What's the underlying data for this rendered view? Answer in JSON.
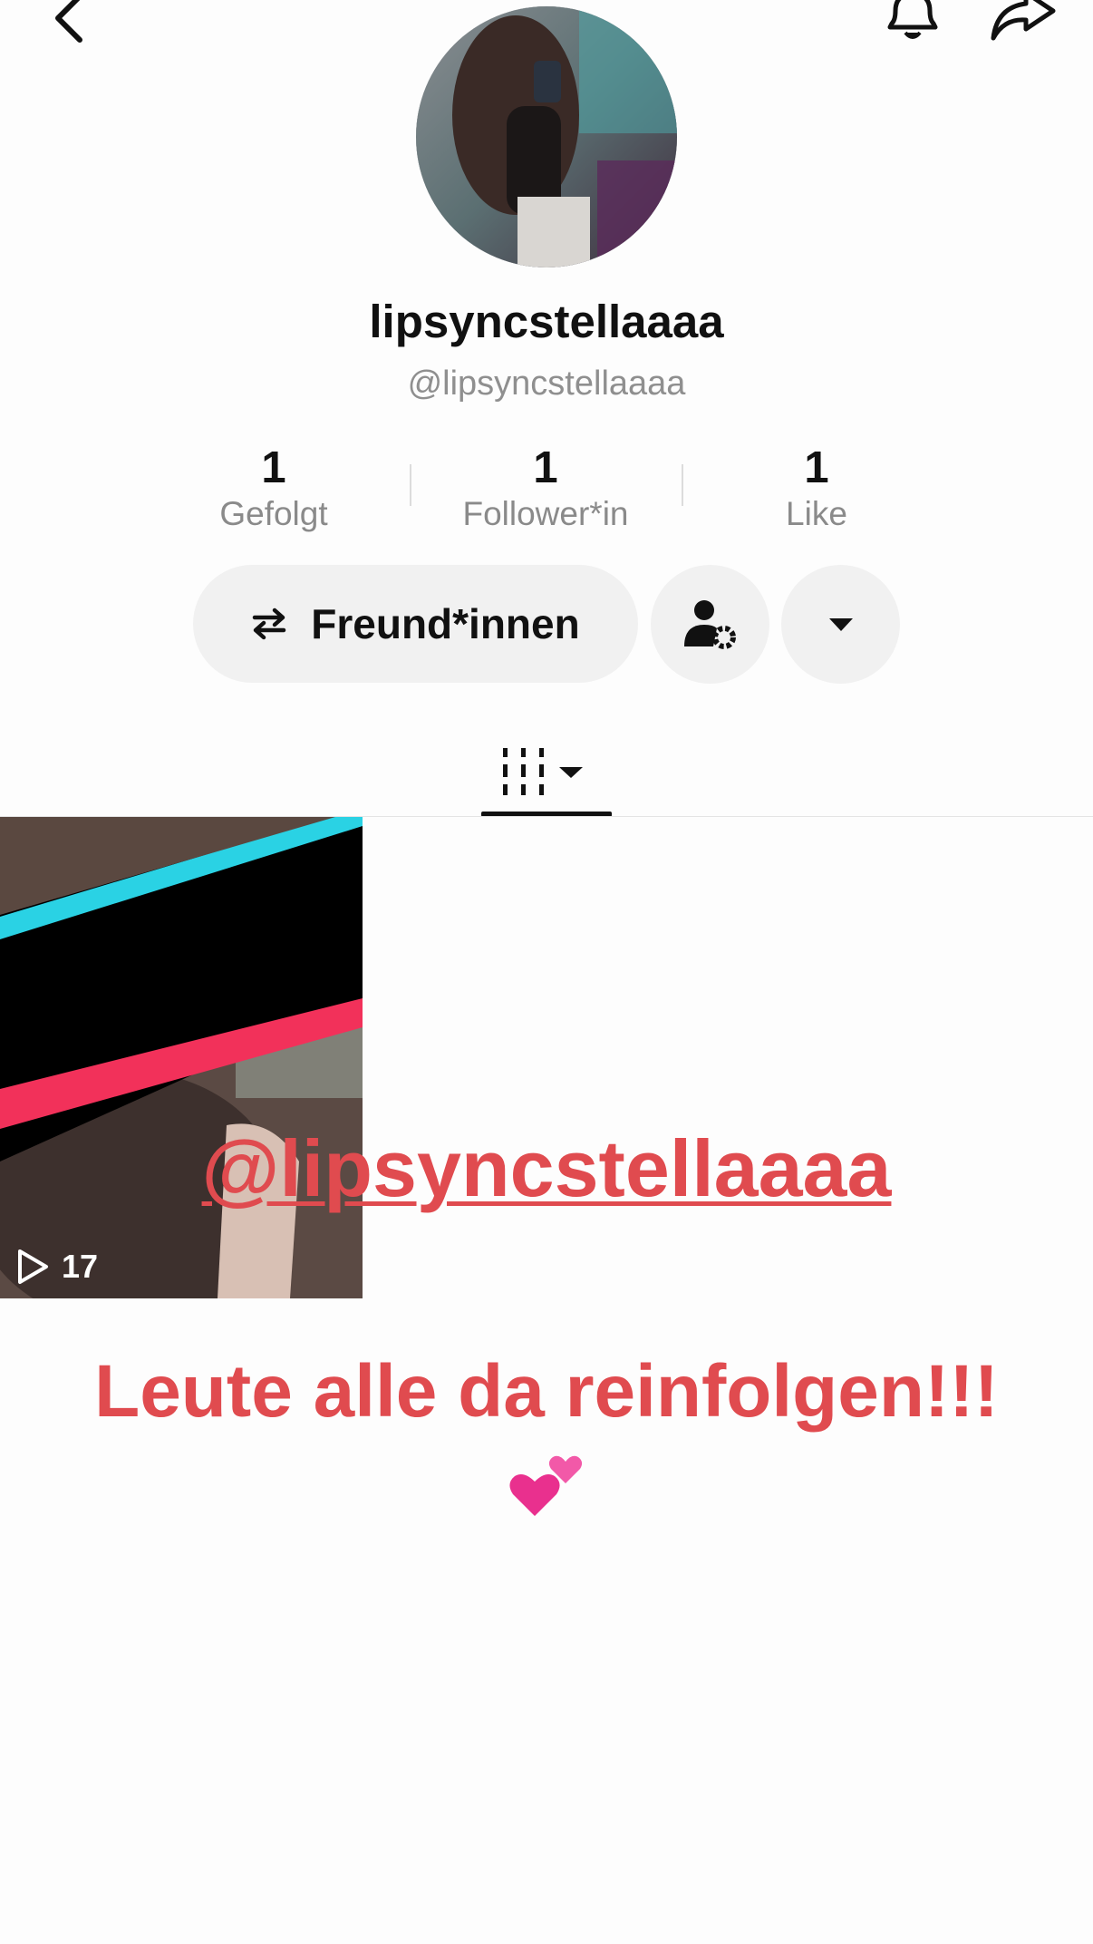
{
  "profile": {
    "display_name": "lipsyncstellaaaa",
    "handle": "@lipsyncstellaaaa"
  },
  "stats": [
    {
      "count": "1",
      "label": "Gefolgt"
    },
    {
      "count": "1",
      "label": "Follower*in"
    },
    {
      "count": "1",
      "label": "Like"
    }
  ],
  "actions": {
    "friends_label": "Freund*innen"
  },
  "videos": [
    {
      "views": "17"
    }
  ],
  "overlay": {
    "mention": "@lipsyncstellaaaa",
    "message": "Leute alle da reinfolgen!!!"
  },
  "icons": {
    "back": "chevron-left-icon",
    "notifications": "bell-icon",
    "share": "share-arrow-icon",
    "friends": "swap-arrows-icon",
    "settings": "user-gear-icon",
    "more": "caret-down-icon",
    "grid_tab": "grid-columns-icon",
    "play": "play-outline-icon",
    "hearts": "two-hearts-icon"
  },
  "colors": {
    "accent": "#e04b4f",
    "tiktok_cyan": "#2ad2e4",
    "tiktok_pink": "#f2315a"
  }
}
